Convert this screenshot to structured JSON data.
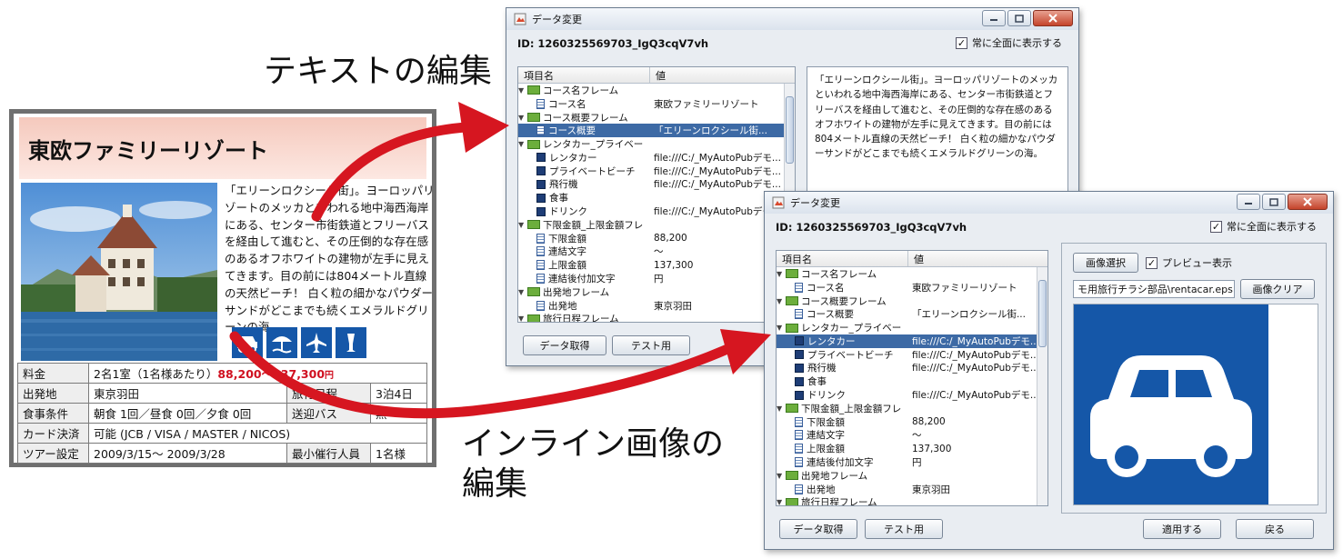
{
  "labels": {
    "text_edit": "テキストの編集",
    "inline_image_edit_line1": "インライン画像の",
    "inline_image_edit_line2": "編集"
  },
  "flyer": {
    "title": "東欧ファミリーリゾート",
    "description": "「エリーンロクシール街」。ヨーロッパリゾートのメッカといわれる地中海西海岸にある、センター市街鉄道とフリーバスを経由して進むと、その圧倒的な存在感のあるオフホワイトの建物が左手に見えてきます。目の前には804メートル直線の天然ビーチ！ 白く粒の細かなパウダーサンドがどこまでも続くエメラルドグリーンの海。",
    "icons": [
      "car-icon",
      "private-beach-icon",
      "airplane-icon",
      "drink-icon"
    ],
    "table": {
      "price_label": "料金",
      "price_prefix": "2名1室（1名様あたり）",
      "price_range": "88,200〜137,300",
      "price_unit": "円",
      "departure_label": "出発地",
      "departure_value": "東京羽田",
      "itinerary_label": "旅行日程",
      "itinerary_value": "3泊4日",
      "meal_label": "食事条件",
      "meal_value": "朝食 1回／昼食 0回／夕食 0回",
      "shuttle_label": "送迎バス",
      "shuttle_value": "無",
      "card_label": "カード決済",
      "card_value": "可能 (JCB / VISA / MASTER / NICOS)",
      "tour_label": "ツアー設定",
      "tour_value": "2009/3/15〜 2009/3/28",
      "min_label": "最小催行人員",
      "min_value": "1名様"
    }
  },
  "window1": {
    "title": "データ変更",
    "id_text": "ID:   1260325569703_IgQ3cqV7vh",
    "always_on_top": "常に全面に表示する",
    "col_name": "項目名",
    "col_value": "値",
    "rows": [
      {
        "name": "コース名フレーム",
        "value": ""
      },
      {
        "name": "コース名",
        "value": "東欧ファミリーリゾート"
      },
      {
        "name": "コース概要フレーム",
        "value": ""
      },
      {
        "name": "コース概要",
        "value": "「エリーンロクシール街..."
      },
      {
        "name": "レンタカー_プライベー",
        "value": ""
      },
      {
        "name": "レンタカー",
        "value": "file:///C:/_MyAutoPubデモ..."
      },
      {
        "name": "プライベートビーチ",
        "value": "file:///C:/_MyAutoPubデモ..."
      },
      {
        "name": "飛行機",
        "value": "file:///C:/_MyAutoPubデモ..."
      },
      {
        "name": "食事",
        "value": ""
      },
      {
        "name": "ドリンク",
        "value": "file:///C:/_MyAutoPubデモ..."
      },
      {
        "name": "下限金額_上限金額フレ",
        "value": ""
      },
      {
        "name": "下限金額",
        "value": "88,200"
      },
      {
        "name": "連結文字",
        "value": "〜"
      },
      {
        "name": "上限金額",
        "value": "137,300"
      },
      {
        "name": "連結後付加文字",
        "value": "円"
      },
      {
        "name": "出発地フレーム",
        "value": ""
      },
      {
        "name": "出発地",
        "value": "東京羽田"
      },
      {
        "name": "旅行日程フレーム",
        "value": ""
      }
    ],
    "text_content": "「エリーンロクシール街」。ヨーロッパリゾートのメッカといわれる地中海西海岸にある、センター市街鉄道とフリーバスを経由して進むと、その圧倒的な存在感のあるオフホワイトの建物が左手に見えてきます。目の前には804メートル直線の天然ビーチ！ 白く粒の細かなパウダーサンドがどこまでも続くエメラルドグリーンの海。",
    "btn_get_data": "データ取得",
    "btn_test": "テスト用"
  },
  "window2": {
    "title": "データ変更",
    "id_text": "ID:   1260325569703_IgQ3cqV7vh",
    "always_on_top": "常に全面に表示する",
    "col_name": "項目名",
    "col_value": "値",
    "rows": [
      {
        "name": "コース名フレーム",
        "value": ""
      },
      {
        "name": "コース名",
        "value": "東欧ファミリーリゾート"
      },
      {
        "name": "コース概要フレーム",
        "value": ""
      },
      {
        "name": "コース概要",
        "value": "「エリーンロクシール街..."
      },
      {
        "name": "レンタカー_プライベー",
        "value": ""
      },
      {
        "name": "レンタカー",
        "value": "file:///C:/_MyAutoPubデモ..."
      },
      {
        "name": "プライベートビーチ",
        "value": "file:///C:/_MyAutoPubデモ..."
      },
      {
        "name": "飛行機",
        "value": "file:///C:/_MyAutoPubデモ..."
      },
      {
        "name": "食事",
        "value": ""
      },
      {
        "name": "ドリンク",
        "value": "file:///C:/_MyAutoPubデモ..."
      },
      {
        "name": "下限金額_上限金額フレ",
        "value": ""
      },
      {
        "name": "下限金額",
        "value": "88,200"
      },
      {
        "name": "連結文字",
        "value": "〜"
      },
      {
        "name": "上限金額",
        "value": "137,300"
      },
      {
        "name": "連結後付加文字",
        "value": "円"
      },
      {
        "name": "出発地フレーム",
        "value": ""
      },
      {
        "name": "出発地",
        "value": "東京羽田"
      },
      {
        "name": "旅行日程フレーム",
        "value": ""
      }
    ],
    "btn_select_image": "画像選択",
    "preview_label": "プレビュー表示",
    "image_path": "モ用旅行チラシ部品\\rentacar.eps",
    "btn_clear_image": "画像クリア",
    "btn_get_data": "データ取得",
    "btn_test": "テスト用",
    "btn_apply": "適用する",
    "btn_back": "戻る"
  },
  "colors": {
    "arrow": "#d61620",
    "selection": "#3d6aa5",
    "car_blue": "#1557a8"
  }
}
